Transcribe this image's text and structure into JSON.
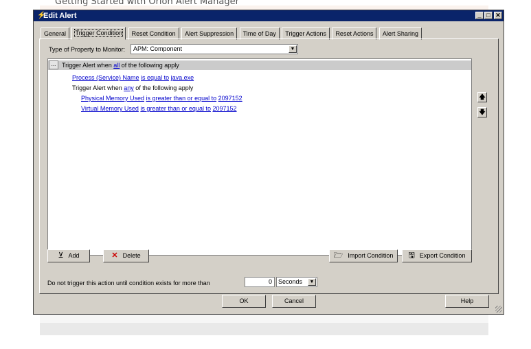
{
  "page": {
    "doc_title": "Getting Started with Orion  Alert Manager"
  },
  "window": {
    "title": "Edit Alert",
    "minimize": "_",
    "maximize": "□",
    "close": "✕"
  },
  "tabs": [
    {
      "label": "General"
    },
    {
      "label": "Trigger Condition",
      "active": true
    },
    {
      "label": "Reset Condition"
    },
    {
      "label": "Alert Suppression"
    },
    {
      "label": "Time of Day"
    },
    {
      "label": "Trigger Actions"
    },
    {
      "label": "Reset Actions"
    },
    {
      "label": "Alert Sharing"
    }
  ],
  "property": {
    "label": "Type of Property to Monitor:",
    "value": "APM: Component"
  },
  "tree": {
    "root": {
      "dots": "...",
      "prefix": "Trigger Alert when ",
      "link": "all",
      "suffix": " of the following apply"
    },
    "cond1": {
      "field": "Process (Service) Name",
      "op": "is equal to",
      "value": "java.exe"
    },
    "group": {
      "prefix": "Trigger Alert when ",
      "link": "any",
      "suffix": " of the following apply"
    },
    "cond2": {
      "field": "Physical Memory Used",
      "op": "is greater than or equal to",
      "value": "2097152"
    },
    "cond3": {
      "field": "Virtual Memory Used",
      "op": "is greater than or equal to",
      "value": "2097152"
    }
  },
  "buttons": {
    "add": "Add",
    "delete": "Delete",
    "import": "Import Condition",
    "export": "Export Condition",
    "ok": "OK",
    "cancel": "Cancel",
    "help": "Help",
    "move_up": "🡅",
    "move_down": "🡇"
  },
  "trigger_delay": {
    "label": "Do not trigger this action until condition exists for more than",
    "value": "0",
    "unit": "Seconds"
  },
  "icons": {
    "add": "filter-add-icon",
    "delete": "delete-x-icon",
    "import": "folder-open-icon",
    "export": "floppy-disk-icon",
    "title": "alert-icon"
  },
  "colors": {
    "titlebar": "#0a246a",
    "dialog": "#d4d0c8",
    "link": "#0000cc",
    "delete_icon": "#cc0000"
  }
}
